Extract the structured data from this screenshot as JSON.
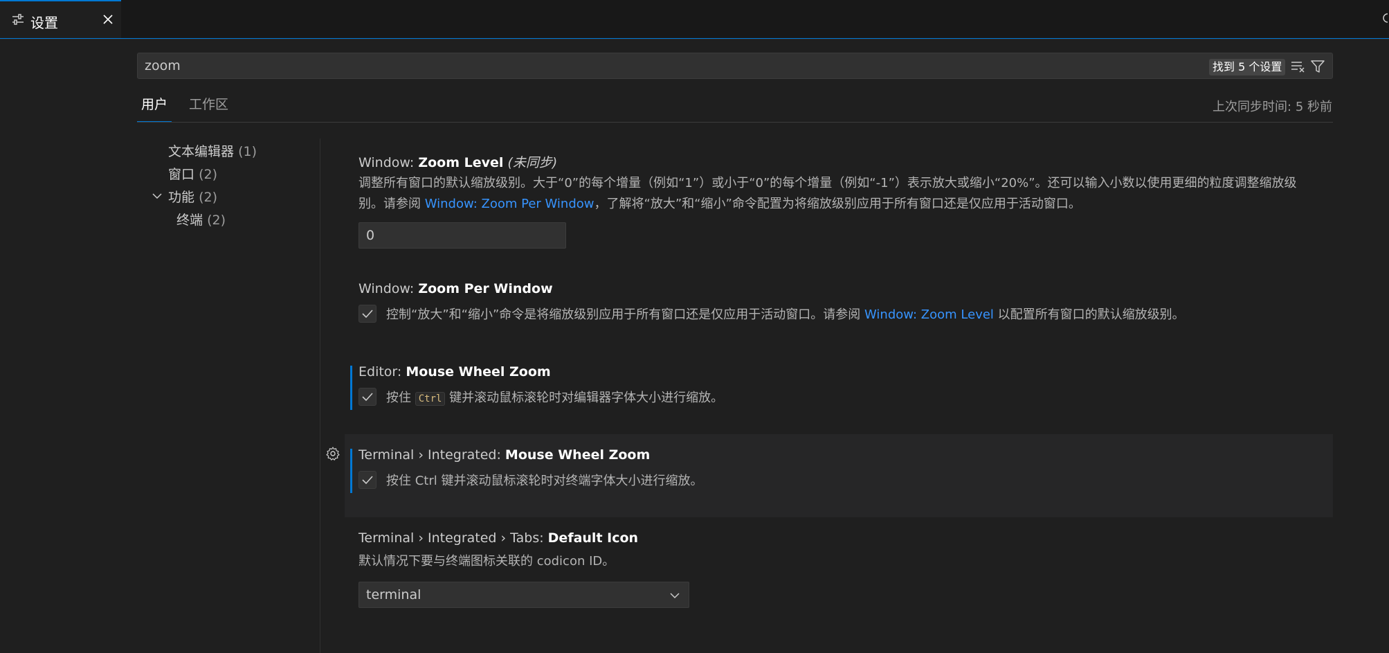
{
  "tab": {
    "label": "设置"
  },
  "search": {
    "value": "zoom",
    "result_count": "找到 5 个设置"
  },
  "scope_tabs": [
    {
      "label": "用户"
    },
    {
      "label": "工作区"
    }
  ],
  "sync_status": "上次同步时间: 5 秒前",
  "toc": [
    {
      "label": "文本编辑器",
      "count": "(1)"
    },
    {
      "label": "窗口",
      "count": "(2)"
    },
    {
      "label": "功能",
      "count": "(2)"
    },
    {
      "label": "终端",
      "count": "(2)"
    }
  ],
  "settings": {
    "zoom_level": {
      "category": "Window: ",
      "key": "Zoom Level",
      "note": "(未同步)",
      "desc_part1": "调整所有窗口的默认缩放级别。大于“0”的每个增量（例如“1”）或小于“0”的每个增量（例如“-1”）表示放大或缩小“20%”。还可以输入小数以使用更细的粒度调整缩放级别。请参阅 ",
      "desc_link": "Window: Zoom Per Window",
      "desc_part2": "，了解将“放大”和“缩小”命令配置为将缩放级别应用于所有窗口还是仅应用于活动窗口。",
      "value": "0"
    },
    "zoom_per_window": {
      "category": "Window: ",
      "key": "Zoom Per Window",
      "desc_part1": "控制“放大”和“缩小”命令是将缩放级别应用于所有窗口还是仅应用于活动窗口。请参阅 ",
      "desc_link": "Window: Zoom Level",
      "desc_part2": " 以配置所有窗口的默认缩放级别。",
      "checked": true
    },
    "editor_mouse_wheel_zoom": {
      "category": "Editor: ",
      "key": "Mouse Wheel Zoom",
      "desc_part1": "按住 ",
      "kbd": "Ctrl",
      "desc_part2": " 键并滚动鼠标滚轮时对编辑器字体大小进行缩放。",
      "checked": true
    },
    "terminal_mouse_wheel_zoom": {
      "category": "Terminal › Integrated: ",
      "key": "Mouse Wheel Zoom",
      "desc": "按住 Ctrl 键并滚动鼠标滚轮时对终端字体大小进行缩放。",
      "checked": true
    },
    "terminal_default_icon": {
      "category": "Terminal › Integrated › Tabs: ",
      "key": "Default Icon",
      "desc": "默认情况下要与终端图标关联的 codicon ID。",
      "value": "terminal"
    }
  },
  "colors": {
    "accent": "#0078d4",
    "link": "#3794ff"
  }
}
